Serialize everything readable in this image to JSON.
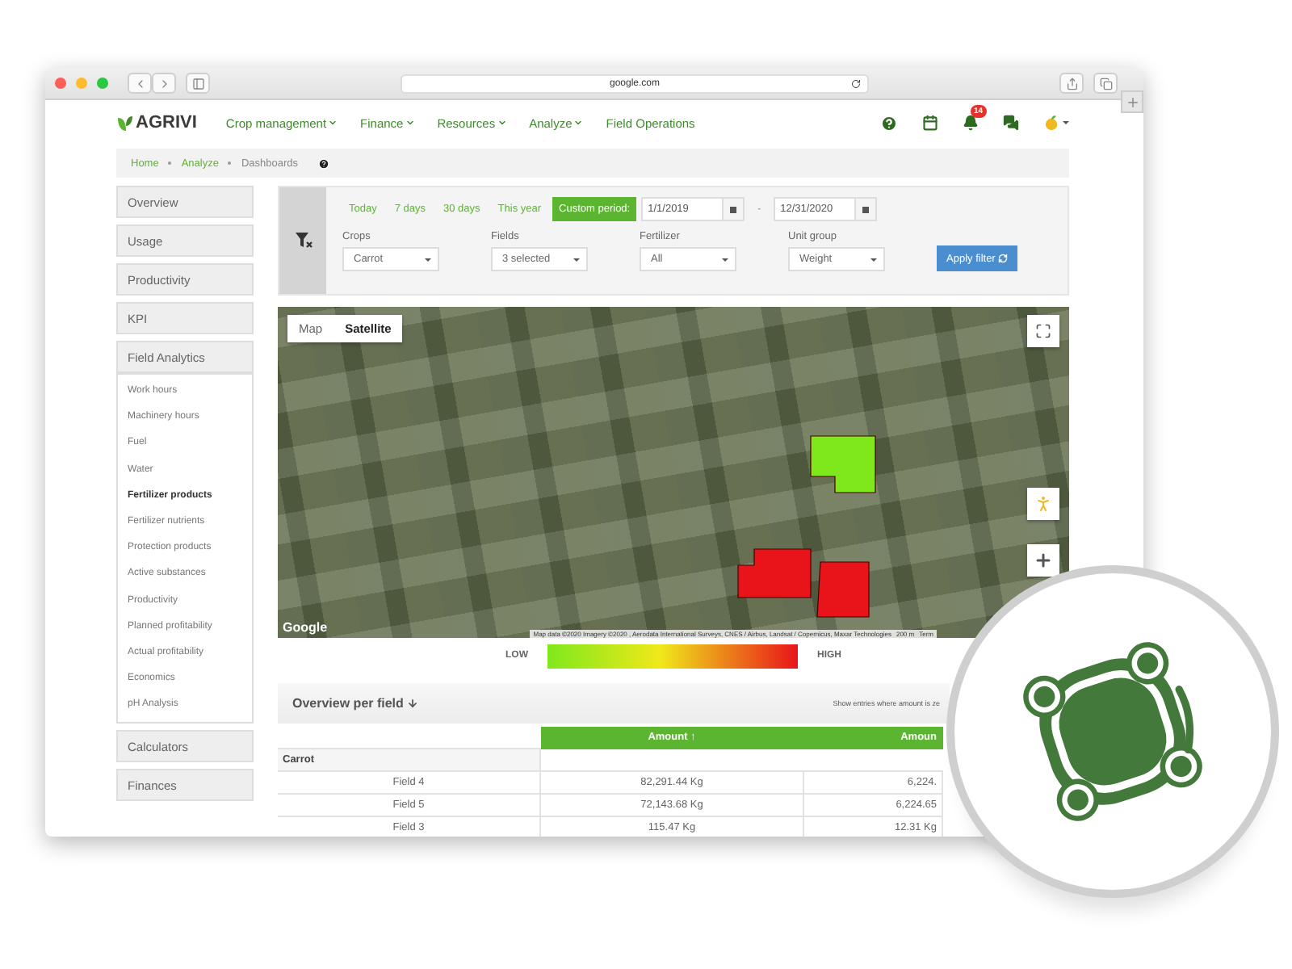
{
  "browser": {
    "address": "google.com"
  },
  "nav": {
    "brand": "AGRIVI",
    "menu": [
      {
        "label": "Crop management",
        "dropdown": true
      },
      {
        "label": "Finance",
        "dropdown": true
      },
      {
        "label": "Resources",
        "dropdown": true
      },
      {
        "label": "Analyze",
        "dropdown": true
      },
      {
        "label": "Field Operations",
        "dropdown": false
      }
    ],
    "notifications": "14"
  },
  "breadcrumb": [
    {
      "label": "Home",
      "kind": "link"
    },
    {
      "label": "Analyze",
      "kind": "link"
    },
    {
      "label": "Dashboards",
      "kind": "current"
    }
  ],
  "sidebar": {
    "items": [
      {
        "label": "Overview"
      },
      {
        "label": "Usage"
      },
      {
        "label": "Productivity"
      },
      {
        "label": "KPI"
      },
      {
        "label": "Field Analytics",
        "children": [
          {
            "label": "Work hours",
            "selected": false
          },
          {
            "label": "Machinery hours",
            "selected": false
          },
          {
            "label": "Fuel",
            "selected": false
          },
          {
            "label": "Water",
            "selected": false
          },
          {
            "label": "Fertilizer products",
            "selected": true
          },
          {
            "label": "Fertilizer nutrients",
            "selected": false
          },
          {
            "label": "Protection products",
            "selected": false
          },
          {
            "label": "Active substances",
            "selected": false
          },
          {
            "label": "Productivity",
            "selected": false
          },
          {
            "label": "Planned profitability",
            "selected": false
          },
          {
            "label": "Actual profitability",
            "selected": false
          },
          {
            "label": "Economics",
            "selected": false
          },
          {
            "label": "pH Analysis",
            "selected": false
          }
        ]
      },
      {
        "label": "Calculators"
      },
      {
        "label": "Finances"
      }
    ]
  },
  "filter": {
    "periods": [
      {
        "label": "Today",
        "selected": false
      },
      {
        "label": "7 days",
        "selected": false
      },
      {
        "label": "30 days",
        "selected": false
      },
      {
        "label": "This year",
        "selected": false
      },
      {
        "label": "Custom period:",
        "selected": true
      }
    ],
    "date_from": "1/1/2019",
    "date_separator": "-",
    "date_to": "12/31/2020",
    "selects": [
      {
        "label": "Crops",
        "value": "Carrot"
      },
      {
        "label": "Fields",
        "value": "3 selected"
      },
      {
        "label": "Fertilizer",
        "value": "All"
      },
      {
        "label": "Unit group",
        "value": "Weight"
      }
    ],
    "apply": "Apply filter"
  },
  "map": {
    "types": [
      {
        "label": "Map",
        "selected": false
      },
      {
        "label": "Satellite",
        "selected": true
      }
    ],
    "fields": [
      {
        "color": "#7fe81c"
      },
      {
        "color": "#e8141a"
      },
      {
        "color": "#e8141a"
      }
    ],
    "logo": "Google",
    "attribution": "Map data ©2020 Imagery ©2020 , Aerodata International Surveys, CNES / Airbus, Landsat / Copernicus, Maxar Technologies",
    "scale": "200 m",
    "terms": "Term"
  },
  "legend": {
    "low": "LOW",
    "high": "HIGH"
  },
  "overview": {
    "title": "Overview per field",
    "note": "Show entries where amount is ze",
    "columns": [
      {},
      {
        "label": "Amount ↑"
      },
      {
        "label": "Amoun"
      }
    ],
    "group": "Carrot",
    "rows": [
      {
        "cells": [
          "Field 4",
          "82,291.44 Kg",
          "6,224."
        ]
      },
      {
        "cells": [
          "Field 5",
          "72,143.68 Kg",
          "6,224.65"
        ]
      },
      {
        "cells": [
          "Field 3",
          "115.47 Kg",
          "12.31 Kg"
        ]
      }
    ]
  }
}
